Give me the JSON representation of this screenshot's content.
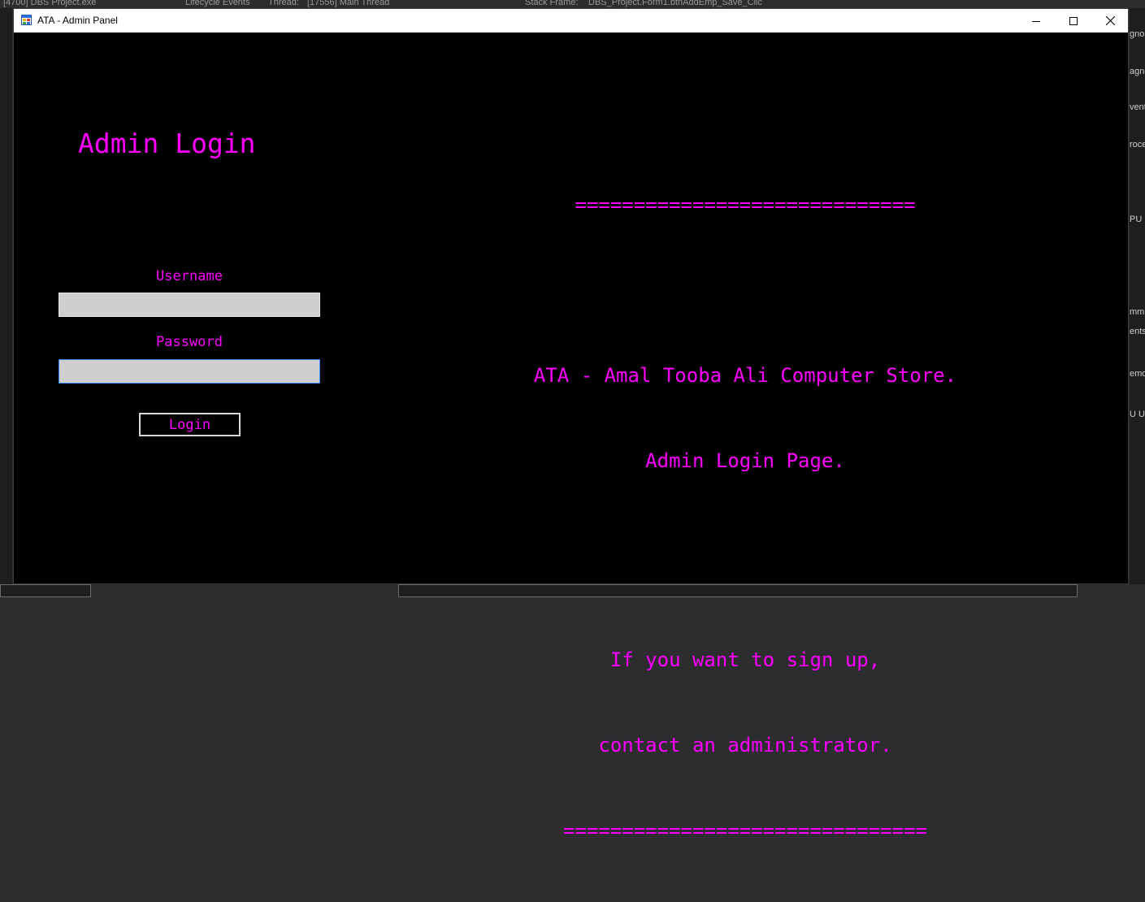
{
  "ide": {
    "topbar_process": "[4700] DBS Project.exe",
    "topbar_lifecycle": "Lifecycle Events",
    "topbar_thread_label": "Thread:",
    "topbar_thread_value": "[17556] Main Thread",
    "topbar_stackframe_label": "Stack Frame:",
    "topbar_stackframe_value": "DBS_Project.Form1.btnAddEmp_Save_Clic",
    "right_panel": [
      "gnos",
      "agne",
      "vent",
      "roce",
      "PU",
      "mm",
      "ents",
      "emo",
      "U U"
    ]
  },
  "window": {
    "title": "ATA - Admin Panel",
    "accent_color": "#ff00ff",
    "background_color": "#000000"
  },
  "login": {
    "heading": "Admin Login",
    "username_label": "Username",
    "username_value": "",
    "password_label": "Password",
    "password_value": "",
    "button_label": "Login"
  },
  "info": {
    "separator_top": "=============================",
    "line1": "ATA - Amal Tooba Ali Computer Store.",
    "line2": "Admin Login Page.",
    "line3": "If you want to sign up,",
    "line4": "contact an administrator.",
    "separator_bottom": "==============================="
  }
}
